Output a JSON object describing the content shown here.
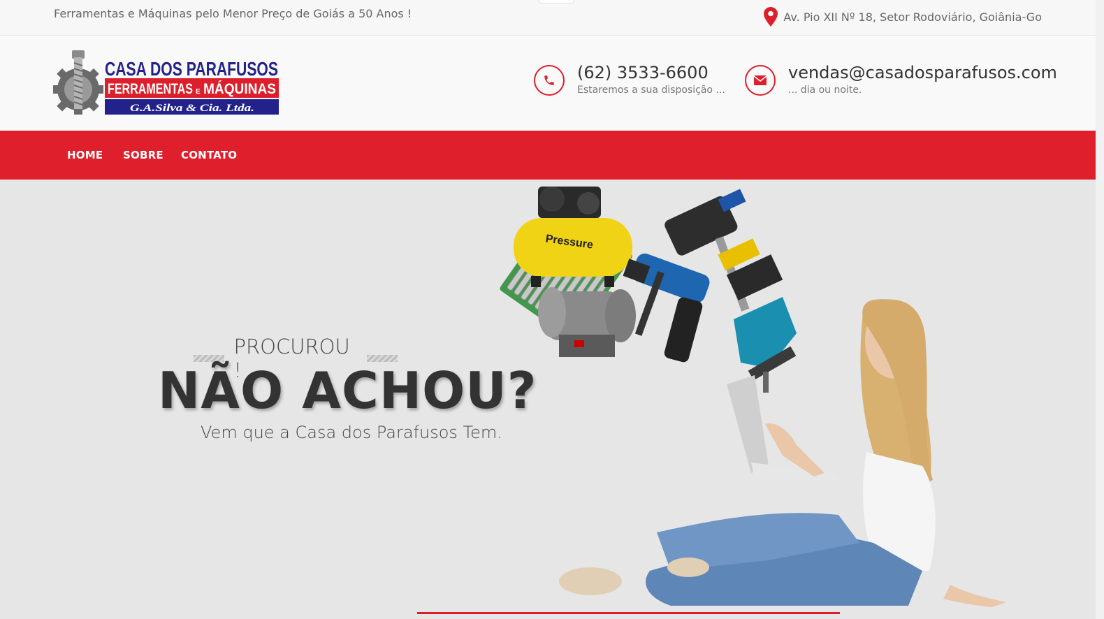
{
  "topbar": {
    "tagline": "Ferramentas e Máquinas pelo Menor Preço de Goiás a 50 Anos !",
    "address": "Av. Pio XII Nº 18, Setor Rodoviário, Goiânia-Go"
  },
  "logo": {
    "line1": "CASA DOS PARAFUSOS",
    "line2a": "FERRAMENTAS",
    "line2b": "E",
    "line2c": "MÁQUINAS",
    "line3": "G.A.Silva & Cia. Ltda."
  },
  "contacts": {
    "phone": {
      "value": "(62) 3533-6600",
      "note": "Estaremos a sua disposição ..."
    },
    "email": {
      "value": "vendas@casadosparafusos.com",
      "note": "... dia ou noite."
    }
  },
  "nav": {
    "items": [
      {
        "label": "HOME"
      },
      {
        "label": "SOBRE"
      },
      {
        "label": "CONTATO"
      }
    ]
  },
  "hero": {
    "pre": "PROCUROU !",
    "title": "NÃO ACHOU?",
    "subtitle": "Vem que a Casa dos Parafusos Tem.",
    "compressor_brand": "Pressure"
  },
  "colors": {
    "accent": "#df202c",
    "logo_blue": "#22228a",
    "hero_bg": "#e6e6e6"
  },
  "icons": {
    "address": "map-pin-icon",
    "phone": "phone-icon",
    "email": "envelope-icon"
  }
}
